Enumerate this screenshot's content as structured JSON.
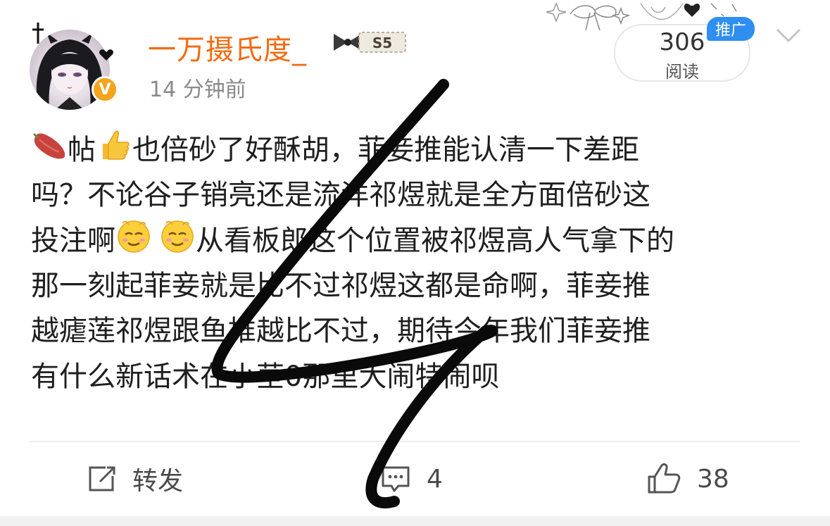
{
  "post": {
    "username": "一万摄氏度_",
    "fan_badge_text": "S5",
    "timestamp": "14 分钟前",
    "read_count": "306",
    "read_label": "阅读",
    "promo_tag": "推广",
    "lines": [
      {
        "pre": "",
        "mid1": "帖",
        "mid2": "也倍砂了好酥胡，菲妾推能认清一下差距"
      },
      {
        "text": "吗？不论谷子销亮还是流洋祁煜就是全方面倍砂这"
      },
      {
        "pre": "投注啊",
        "post": "从看板郎这个位置被祁煜高人气拿下的"
      },
      {
        "text": "那一刻起菲妾就是比不过祁煜这都是命啊，菲妾推"
      },
      {
        "text": "越瘧莲祁煜跟鱼推越比不过，期待今年我们菲妾推"
      },
      {
        "text": "有什么新话术在小茎0那里大闹特闹呗"
      }
    ]
  },
  "actions": {
    "repost_label": "转发",
    "comment_count": "4",
    "like_count": "38"
  },
  "icons": {
    "sweet_potato": "sweet-potato-icon",
    "thumbs_up": "thumbs-up-emoji-icon",
    "smug_face": "smug-face-emoji-icon",
    "repost": "repost-icon",
    "comment": "comment-icon",
    "like": "like-icon",
    "more": "chevron-down-icon"
  },
  "colors": {
    "username": "#f26b10",
    "promo_tag": "#2f8ff0",
    "verified_badge": "#f6a31d",
    "scribble": "#0a0a0a"
  }
}
